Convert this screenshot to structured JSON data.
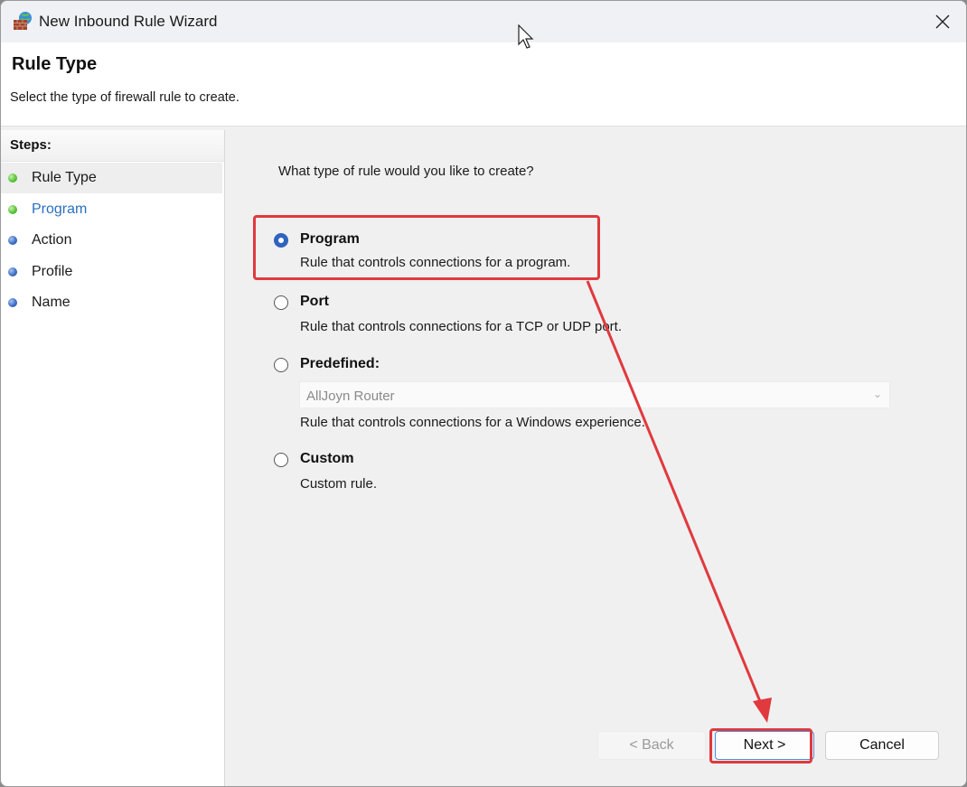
{
  "window": {
    "title": "New Inbound Rule Wizard",
    "icon": "firewall-globe-icon",
    "close_icon": "close-icon"
  },
  "header": {
    "title": "Rule Type",
    "subtitle": "Select the type of firewall rule to create."
  },
  "steps": {
    "label": "Steps:",
    "items": [
      {
        "label": "Rule Type",
        "status": "completed",
        "current": true
      },
      {
        "label": "Program",
        "status": "completed",
        "current": false,
        "link": true
      },
      {
        "label": "Action",
        "status": "pending",
        "current": false
      },
      {
        "label": "Profile",
        "status": "pending",
        "current": false
      },
      {
        "label": "Name",
        "status": "pending",
        "current": false
      }
    ]
  },
  "main": {
    "question": "What type of rule would you like to create?",
    "options": [
      {
        "label": "Program",
        "description": "Rule that controls connections for a program.",
        "selected": true
      },
      {
        "label": "Port",
        "description": "Rule that controls connections for a TCP or UDP port.",
        "selected": false
      },
      {
        "label": "Predefined:",
        "description": "Rule that controls connections for a Windows experience.",
        "selected": false
      },
      {
        "label": "Custom",
        "description": "Custom rule.",
        "selected": false
      }
    ],
    "predefined_dropdown": {
      "value": "AllJoyn Router",
      "enabled": false
    }
  },
  "buttons": {
    "back": "< Back",
    "next": "Next >",
    "cancel": "Cancel"
  },
  "annotation": {
    "color": "#e0393e"
  }
}
